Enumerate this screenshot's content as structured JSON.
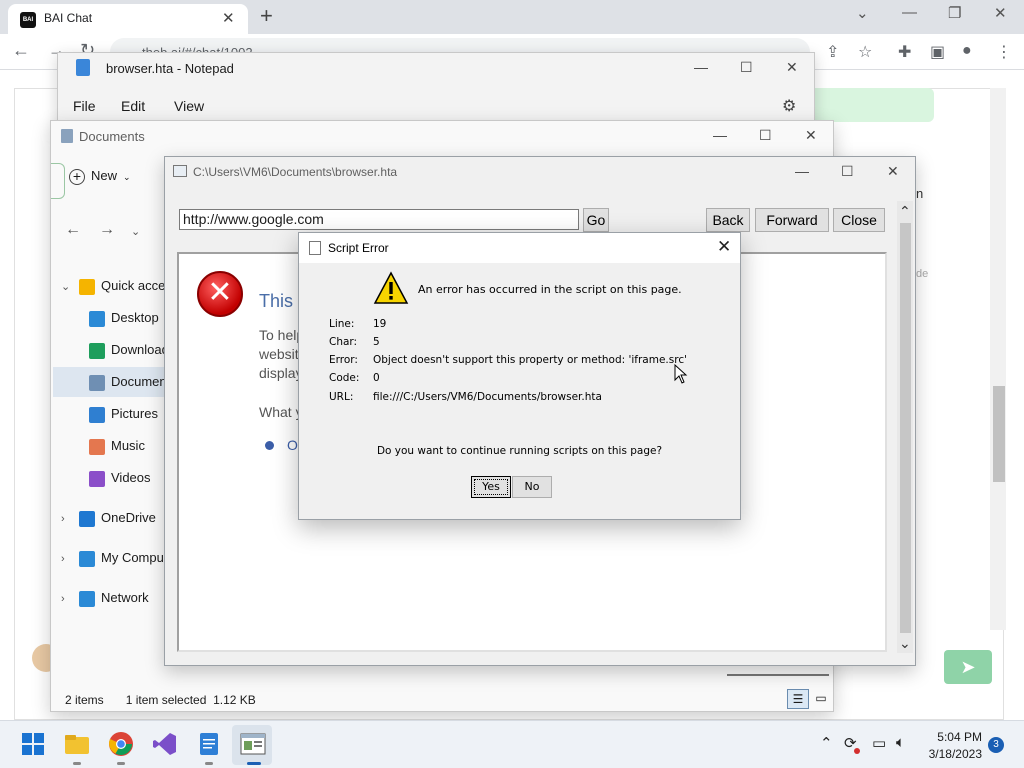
{
  "chrome": {
    "tab_title": "BAI Chat",
    "tab_favicon_text": "BAI",
    "url": "theb.ai/#/chat/1002",
    "web_partial_n": "n",
    "web_partial_de": "de"
  },
  "notepad": {
    "title": "browser.hta - Notepad",
    "menu": [
      "File",
      "Edit",
      "View"
    ]
  },
  "explorer": {
    "title": "Documents",
    "new_label": "New",
    "sidebar": [
      {
        "label": "Quick access",
        "icon": "star-icon",
        "color": "#f5b400",
        "expandable": true,
        "expanded": true
      },
      {
        "label": "Desktop",
        "icon": "desktop-icon",
        "color": "#2b8ad6"
      },
      {
        "label": "Downloads",
        "icon": "download-icon",
        "color": "#1e9e5c"
      },
      {
        "label": "Documents",
        "icon": "documents-icon",
        "color": "#6f8fb3",
        "selected": true
      },
      {
        "label": "Pictures",
        "icon": "pictures-icon",
        "color": "#2f7fd1"
      },
      {
        "label": "Music",
        "icon": "music-icon",
        "color": "#e4774f"
      },
      {
        "label": "Videos",
        "icon": "videos-icon",
        "color": "#8b4fc9"
      },
      {
        "label": "OneDrive",
        "icon": "cloud-icon",
        "color": "#1f78d1",
        "expandable": true
      },
      {
        "label": "My Computer",
        "icon": "computer-icon",
        "color": "#2b8ad6",
        "expandable": true
      },
      {
        "label": "Network",
        "icon": "network-icon",
        "color": "#2b8ad6",
        "expandable": true
      }
    ],
    "status_items": "2 items",
    "status_selected": "1 item selected  1.12 KB"
  },
  "hta": {
    "title": "C:\\Users\\VM6\\Documents\\browser.hta",
    "url_value": "http://www.google.com",
    "go": "Go",
    "back": "Back",
    "forward": "Forward",
    "close": "Close",
    "page_heading": "This c",
    "page_line1": "To help",
    "page_line2": "website",
    "page_line3": "display",
    "page_what": "What y",
    "page_op": "Op"
  },
  "dialog": {
    "title": "Script Error",
    "message": "An error has occurred in the script on this page.",
    "fields": [
      {
        "label": "Line:",
        "value": "19"
      },
      {
        "label": "Char:",
        "value": "5"
      },
      {
        "label": "Error:",
        "value": "Object doesn't support this property or method: 'iframe.src'"
      },
      {
        "label": "Code:",
        "value": "0"
      },
      {
        "label": "URL:",
        "value": "file:///C:/Users/VM6/Documents/browser.hta"
      }
    ],
    "question": "Do you want to continue running scripts on this page?",
    "yes": "Yes",
    "no": "No"
  },
  "taskbar": {
    "time": "5:04 PM",
    "date": "3/18/2023",
    "notification_count": "3",
    "apps": [
      "start-icon",
      "file-explorer-icon",
      "chrome-icon",
      "visual-studio-icon",
      "notepad-icon",
      "hta-app-icon"
    ]
  }
}
